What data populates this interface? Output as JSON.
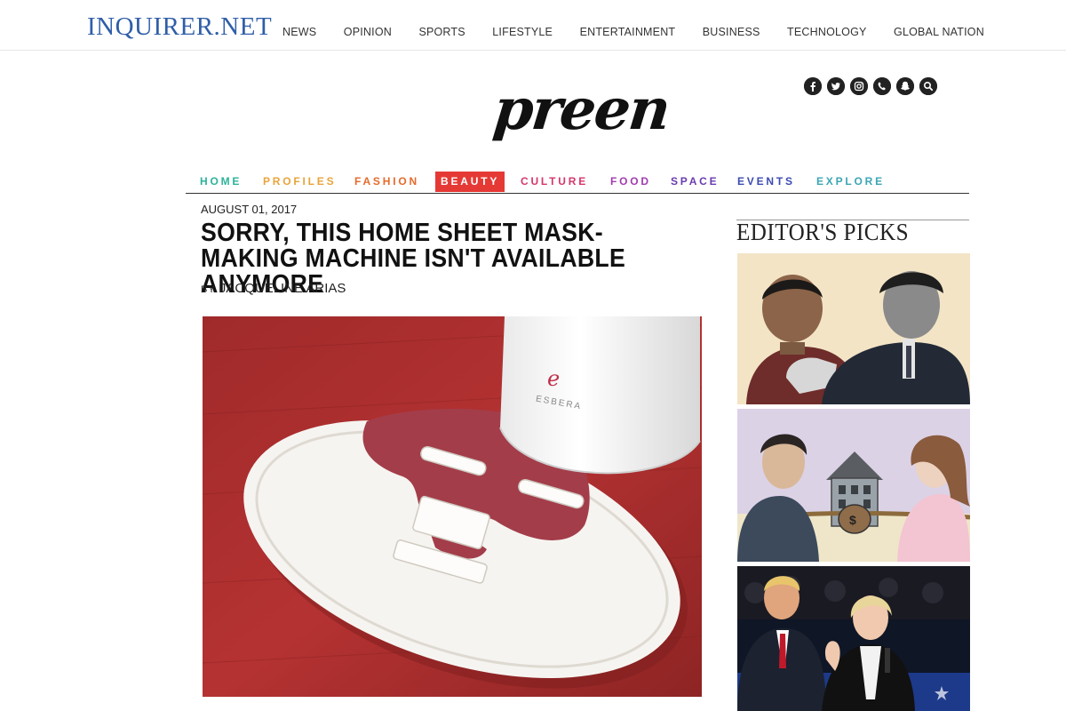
{
  "site": {
    "logo": "INQUIRER.NET",
    "nav": [
      "NEWS",
      "OPINION",
      "SPORTS",
      "LIFESTYLE",
      "ENTERTAINMENT",
      "BUSINESS",
      "TECHNOLOGY",
      "GLOBAL NATION"
    ]
  },
  "social_icons": [
    "facebook-icon",
    "twitter-icon",
    "instagram-icon",
    "viber-icon",
    "snapchat-icon",
    "search-icon"
  ],
  "preen": {
    "logo": "preen",
    "nav": [
      {
        "label": "HOME",
        "color": "#2bb39a"
      },
      {
        "label": "PROFILES",
        "color": "#e8a43a"
      },
      {
        "label": "FASHION",
        "color": "#e56a2b"
      },
      {
        "label": "BEAUTY",
        "color": "#e53935",
        "active": true
      },
      {
        "label": "CULTURE",
        "color": "#d4366e"
      },
      {
        "label": "FOOD",
        "color": "#a23bb0"
      },
      {
        "label": "SPACE",
        "color": "#6a3bb0"
      },
      {
        "label": "EVENTS",
        "color": "#3b4bb0"
      },
      {
        "label": "EXPLORE",
        "color": "#3ba6b5"
      }
    ]
  },
  "article": {
    "date": "AUGUST 01, 2017",
    "headline": "SORRY, THIS HOME SHEET MASK-MAKING MACHINE ISN'T AVAILABLE ANYMORE",
    "by_label": "BY",
    "author": "JACQUELINE ARIAS",
    "hero_brand": "ESBERA"
  },
  "sidebar": {
    "title": "EDITOR'S PICKS"
  },
  "colors": {
    "inquirer_blue": "#2f5ea8",
    "beauty_red": "#e53935"
  }
}
